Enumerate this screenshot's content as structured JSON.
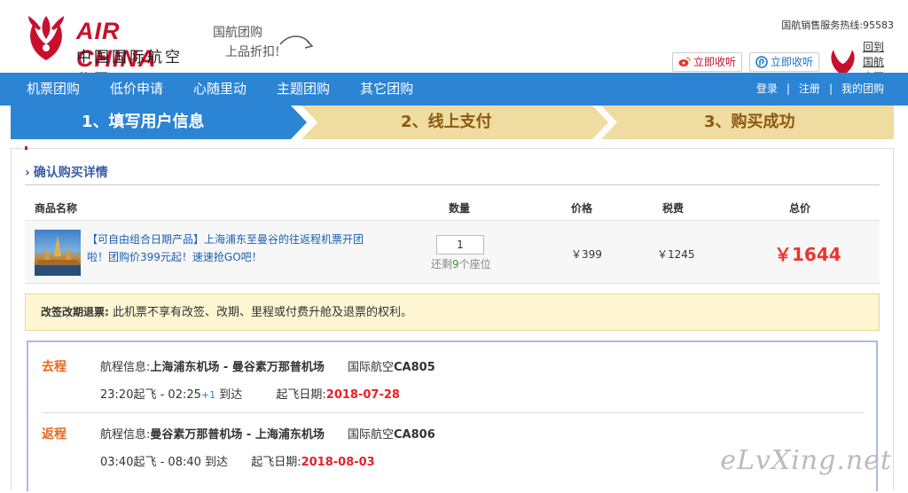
{
  "header": {
    "brand": "AIR CHINA",
    "brand_cn": "中国国际航空公司",
    "slogan_1": "国航团购",
    "slogan_2": "上品折扣!",
    "hotline": "国航销售服务热线:95583",
    "weibo_label": "立即收听",
    "qq_label": "立即收听",
    "official_label": "回到国航官网"
  },
  "nav": {
    "items": [
      "机票团购",
      "低价申请",
      "心随里动",
      "主题团购",
      "其它团购"
    ],
    "login": "登录",
    "sep": "|",
    "register": "注册",
    "my_group": "我的团购"
  },
  "steps": [
    {
      "label": "1、填写用户信息",
      "active": true
    },
    {
      "label": "2、线上支付",
      "active": false
    },
    {
      "label": "3、购买成功",
      "active": false
    }
  ],
  "order": {
    "section_title": "确认购买详情",
    "columns": {
      "name": "商品名称",
      "qty": "数量",
      "price": "价格",
      "tax": "税费",
      "total": "总价"
    },
    "item": {
      "title": "【可自由组合日期产品】上海浦东至曼谷的往返程机票开团啦！团购价399元起！速速抢GO吧！",
      "qty": "1",
      "remain_prefix": "还剩",
      "remain_count": "9",
      "remain_suffix": "个座位",
      "price": "￥399",
      "tax": "￥1245",
      "total": "￥1644"
    },
    "notice_label": "改签改期退票:",
    "notice_text": " 此机票不享有改签、改期、里程或付费升舱及退票的权利。"
  },
  "flights": [
    {
      "tag": "去程",
      "route_label": "航程信息:",
      "route": "上海浦东机场 - 曼谷素万那普机场",
      "airline": "国际航空",
      "flight_no": "CA805",
      "dep_time": "23:20起飞 - 02:25",
      "plus": "+1",
      "arrive": "到达",
      "date_label": "起飞日期:",
      "date": "2018-07-28"
    },
    {
      "tag": "返程",
      "route_label": "航程信息:",
      "route": "曼谷素万那普机场 - 上海浦东机场",
      "airline": "国际航空",
      "flight_no": "CA806",
      "dep_time": "03:40起飞 - 08:40",
      "plus": "",
      "arrive": "到达",
      "date_label": "起飞日期:",
      "date": "2018-08-03"
    }
  ],
  "watermark": "eLvXing.net",
  "colors": {
    "nav": "#2c84d4",
    "step_active": "#2c84d4",
    "step_inactive": "#f0dba0",
    "accent_red": "#e8362c",
    "link_blue": "#1a5fb4"
  }
}
